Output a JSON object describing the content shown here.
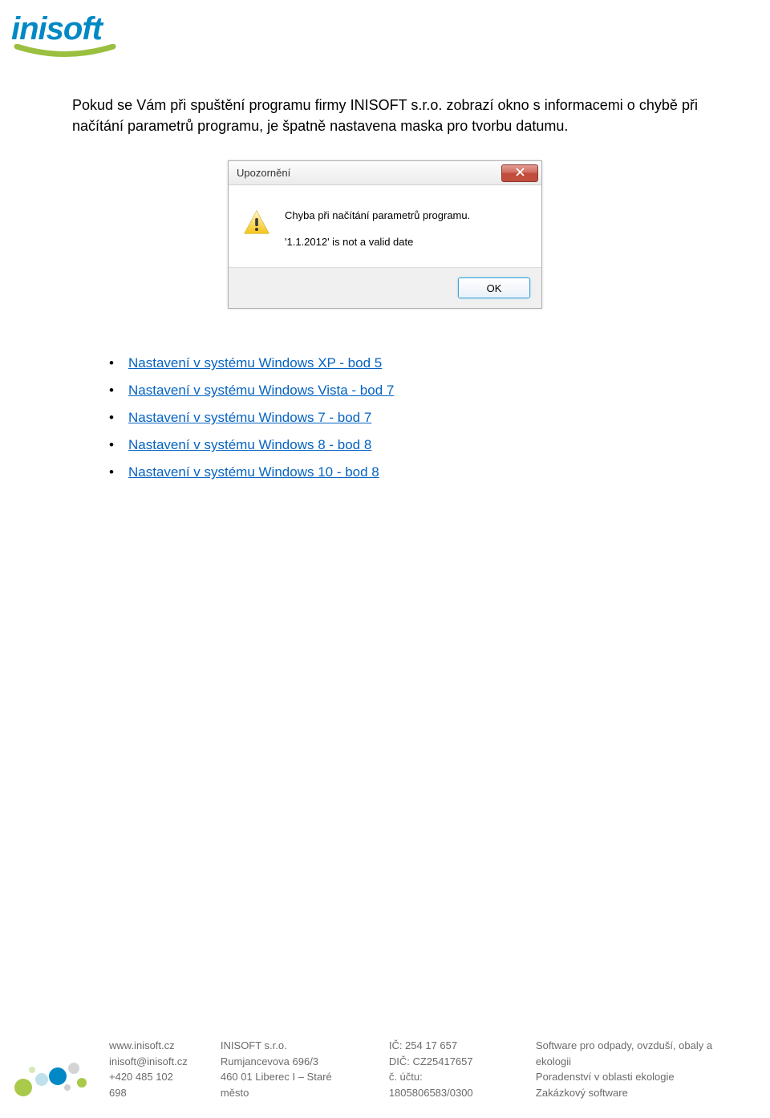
{
  "logo": {
    "text": "inisoft"
  },
  "paragraph": "Pokud se Vám při spuštění programu firmy INISOFT s.r.o. zobrazí okno s informacemi o chybě při načítání parametrů programu, je špatně nastavena maska pro tvorbu datumu.",
  "dialog": {
    "title": "Upozornění",
    "message1": "Chyba při načítání parametrů programu.",
    "message2": "'1.1.2012' is not a valid date",
    "ok_label": "OK"
  },
  "links": [
    "Nastavení v systému Windows XP - bod 5",
    "Nastavení v systému Windows Vista - bod 7",
    "Nastavení v systému Windows 7 - bod 7",
    "Nastavení v systému Windows 8 - bod 8",
    "Nastavení v systému Windows 10 - bod 8"
  ],
  "footer": {
    "col1": {
      "line1": "www.inisoft.cz",
      "line2": "inisoft@inisoft.cz",
      "line3": "+420 485 102 698"
    },
    "col2": {
      "line1": "INISOFT s.r.o.",
      "line2": "Rumjancevova 696/3",
      "line3": "460 01 Liberec I – Staré město"
    },
    "col3": {
      "line1": "IČ: 254 17 657",
      "line2": "DIČ: CZ25417657",
      "line3": "č. účtu: 1805806583/0300"
    },
    "col4": {
      "line1": "Software pro odpady, ovzduší, obaly a ekologii",
      "line2": "Poradenství v oblasti ekologie",
      "line3": "Zakázkový software"
    }
  }
}
